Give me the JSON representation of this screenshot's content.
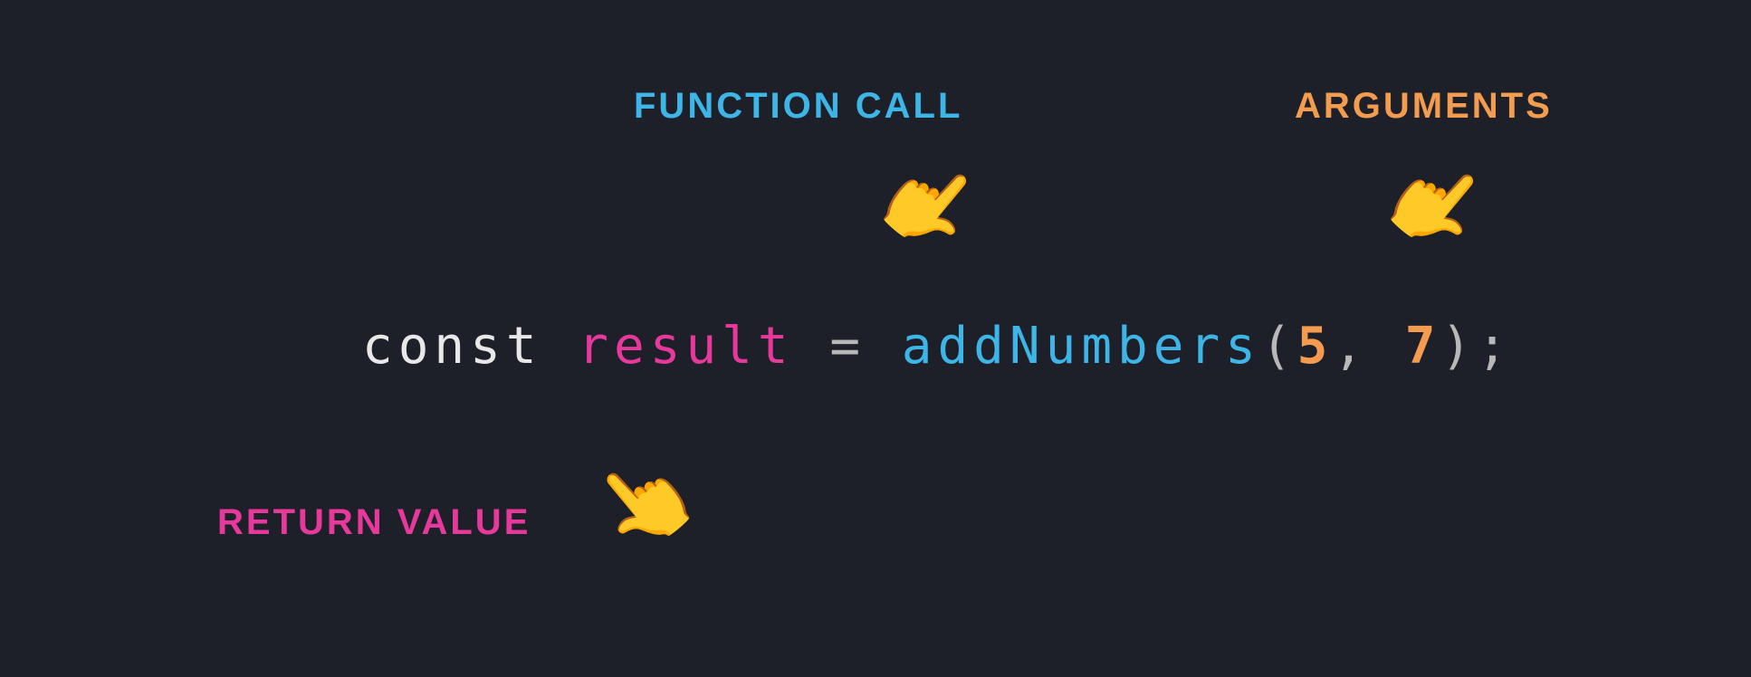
{
  "labels": {
    "function_call": "FUNCTION CALL",
    "arguments": "ARGUMENTS",
    "return_value": "RETURN VALUE"
  },
  "pointer_emoji": "👆",
  "code": {
    "keyword": "const",
    "variable": "result",
    "equals": "=",
    "function_name": "addNumbers",
    "paren_open": "(",
    "arg1": "5",
    "comma": ",",
    "arg2": "7",
    "paren_close": ")",
    "semicolon": ";"
  },
  "colors": {
    "background": "#1e2029",
    "function_call_label": "#3db5e6",
    "arguments_label": "#f39c4f",
    "return_value_label": "#e6399b",
    "keyword": "#e8e8e8",
    "variable": "#e6399b",
    "operator": "#b8b8b8",
    "function": "#3db5e6",
    "number": "#f39c4f"
  }
}
